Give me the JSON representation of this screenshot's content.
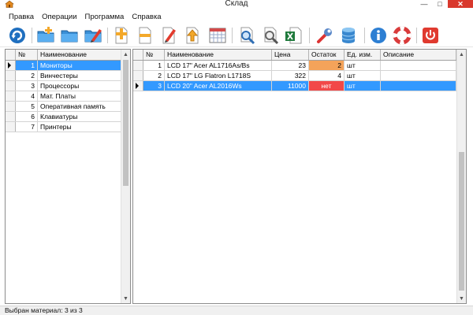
{
  "window": {
    "title": "Склад",
    "minimize": "—",
    "maximize": "□",
    "close": "✕"
  },
  "menu": [
    "Правка",
    "Операции",
    "Программа",
    "Справка"
  ],
  "toolbar_icons": [
    "refresh-icon",
    "add-folder-icon",
    "open-folder-icon",
    "edit-folder-icon",
    "add-item-icon",
    "remove-item-icon",
    "edit-item-icon",
    "move-up-icon",
    "calendar-icon",
    "search-icon",
    "print-preview-icon",
    "export-excel-icon",
    "settings-wrench-icon",
    "database-icon",
    "info-icon",
    "help-lifebuoy-icon",
    "exit-power-icon"
  ],
  "categories": {
    "columns": [
      "№",
      "Наименование"
    ],
    "rows": [
      {
        "n": "1",
        "name": "Мониторы",
        "selected": true
      },
      {
        "n": "2",
        "name": "Винчестеры"
      },
      {
        "n": "3",
        "name": "Процессоры"
      },
      {
        "n": "4",
        "name": "Мат. Платы"
      },
      {
        "n": "5",
        "name": "Оперативная память"
      },
      {
        "n": "6",
        "name": "Клавиатуры"
      },
      {
        "n": "7",
        "name": "Принтеры"
      }
    ]
  },
  "materials": {
    "columns": [
      "№",
      "Наименование",
      "Цена",
      "Остаток",
      "Ед. изм.",
      "Описание"
    ],
    "rows": [
      {
        "n": "1",
        "name": "LCD 17\" Acer AL1716As/Bs",
        "price": "23",
        "stock": "2",
        "unit": "шт",
        "desc": "",
        "stock_status": "low"
      },
      {
        "n": "2",
        "name": "LCD 17\" LG Flatron L1718S",
        "price": "322",
        "stock": "4",
        "unit": "шт",
        "desc": "",
        "stock_status": "ok"
      },
      {
        "n": "3",
        "name": "LCD 20\" Acer AL2016Ws",
        "price": "11000",
        "stock": "нет",
        "unit": "шт",
        "desc": "",
        "stock_status": "none",
        "selected": true
      }
    ]
  },
  "status": "Выбран материал: 3 из 3",
  "colors": {
    "selection": "#3399ff",
    "low_stock": "#f4a35a",
    "no_stock": "#f24848",
    "close_button": "#d9382c"
  }
}
